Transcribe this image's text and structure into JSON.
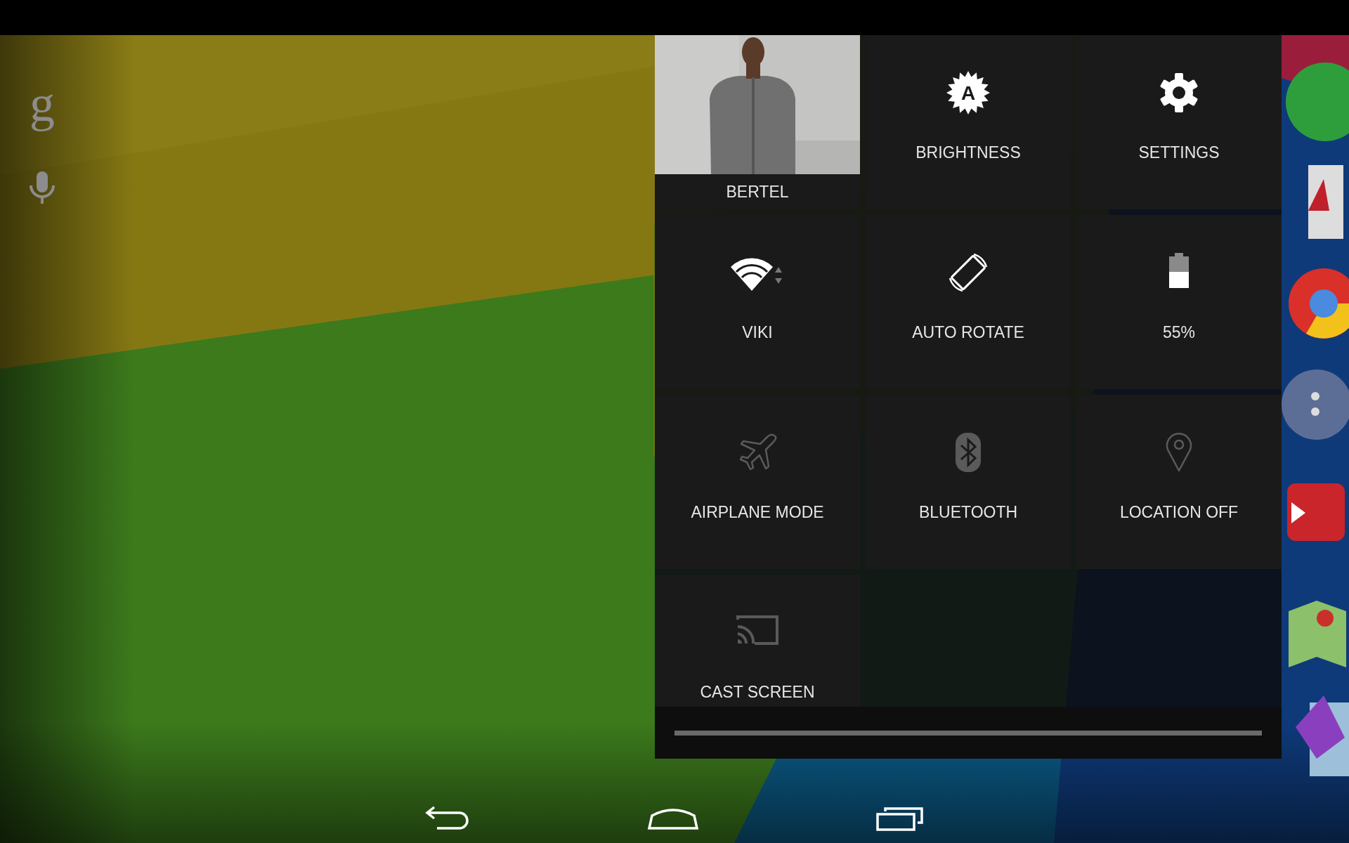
{
  "launcher": {
    "search_logo": "g"
  },
  "profile": {
    "name": "BERTEL",
    "kind": "picture"
  },
  "tiles": [
    {
      "kind": "brightness",
      "label": "BRIGHTNESS",
      "on": true,
      "icon_text": "A"
    },
    {
      "kind": "settings",
      "label": "SETTINGS",
      "on": true
    },
    {
      "kind": "wifi",
      "label": "VIKI",
      "on": true
    },
    {
      "kind": "rotate",
      "label": "AUTO ROTATE",
      "on": true
    },
    {
      "kind": "battery",
      "label": "55%",
      "on": true
    },
    {
      "kind": "airplane",
      "label": "AIRPLANE MODE",
      "on": false
    },
    {
      "kind": "bluetooth",
      "label": "BLUETOOTH",
      "on": false
    },
    {
      "kind": "location",
      "label": "LOCATION OFF",
      "on": false
    },
    {
      "kind": "cast",
      "label": "CAST SCREEN",
      "on": false
    }
  ]
}
